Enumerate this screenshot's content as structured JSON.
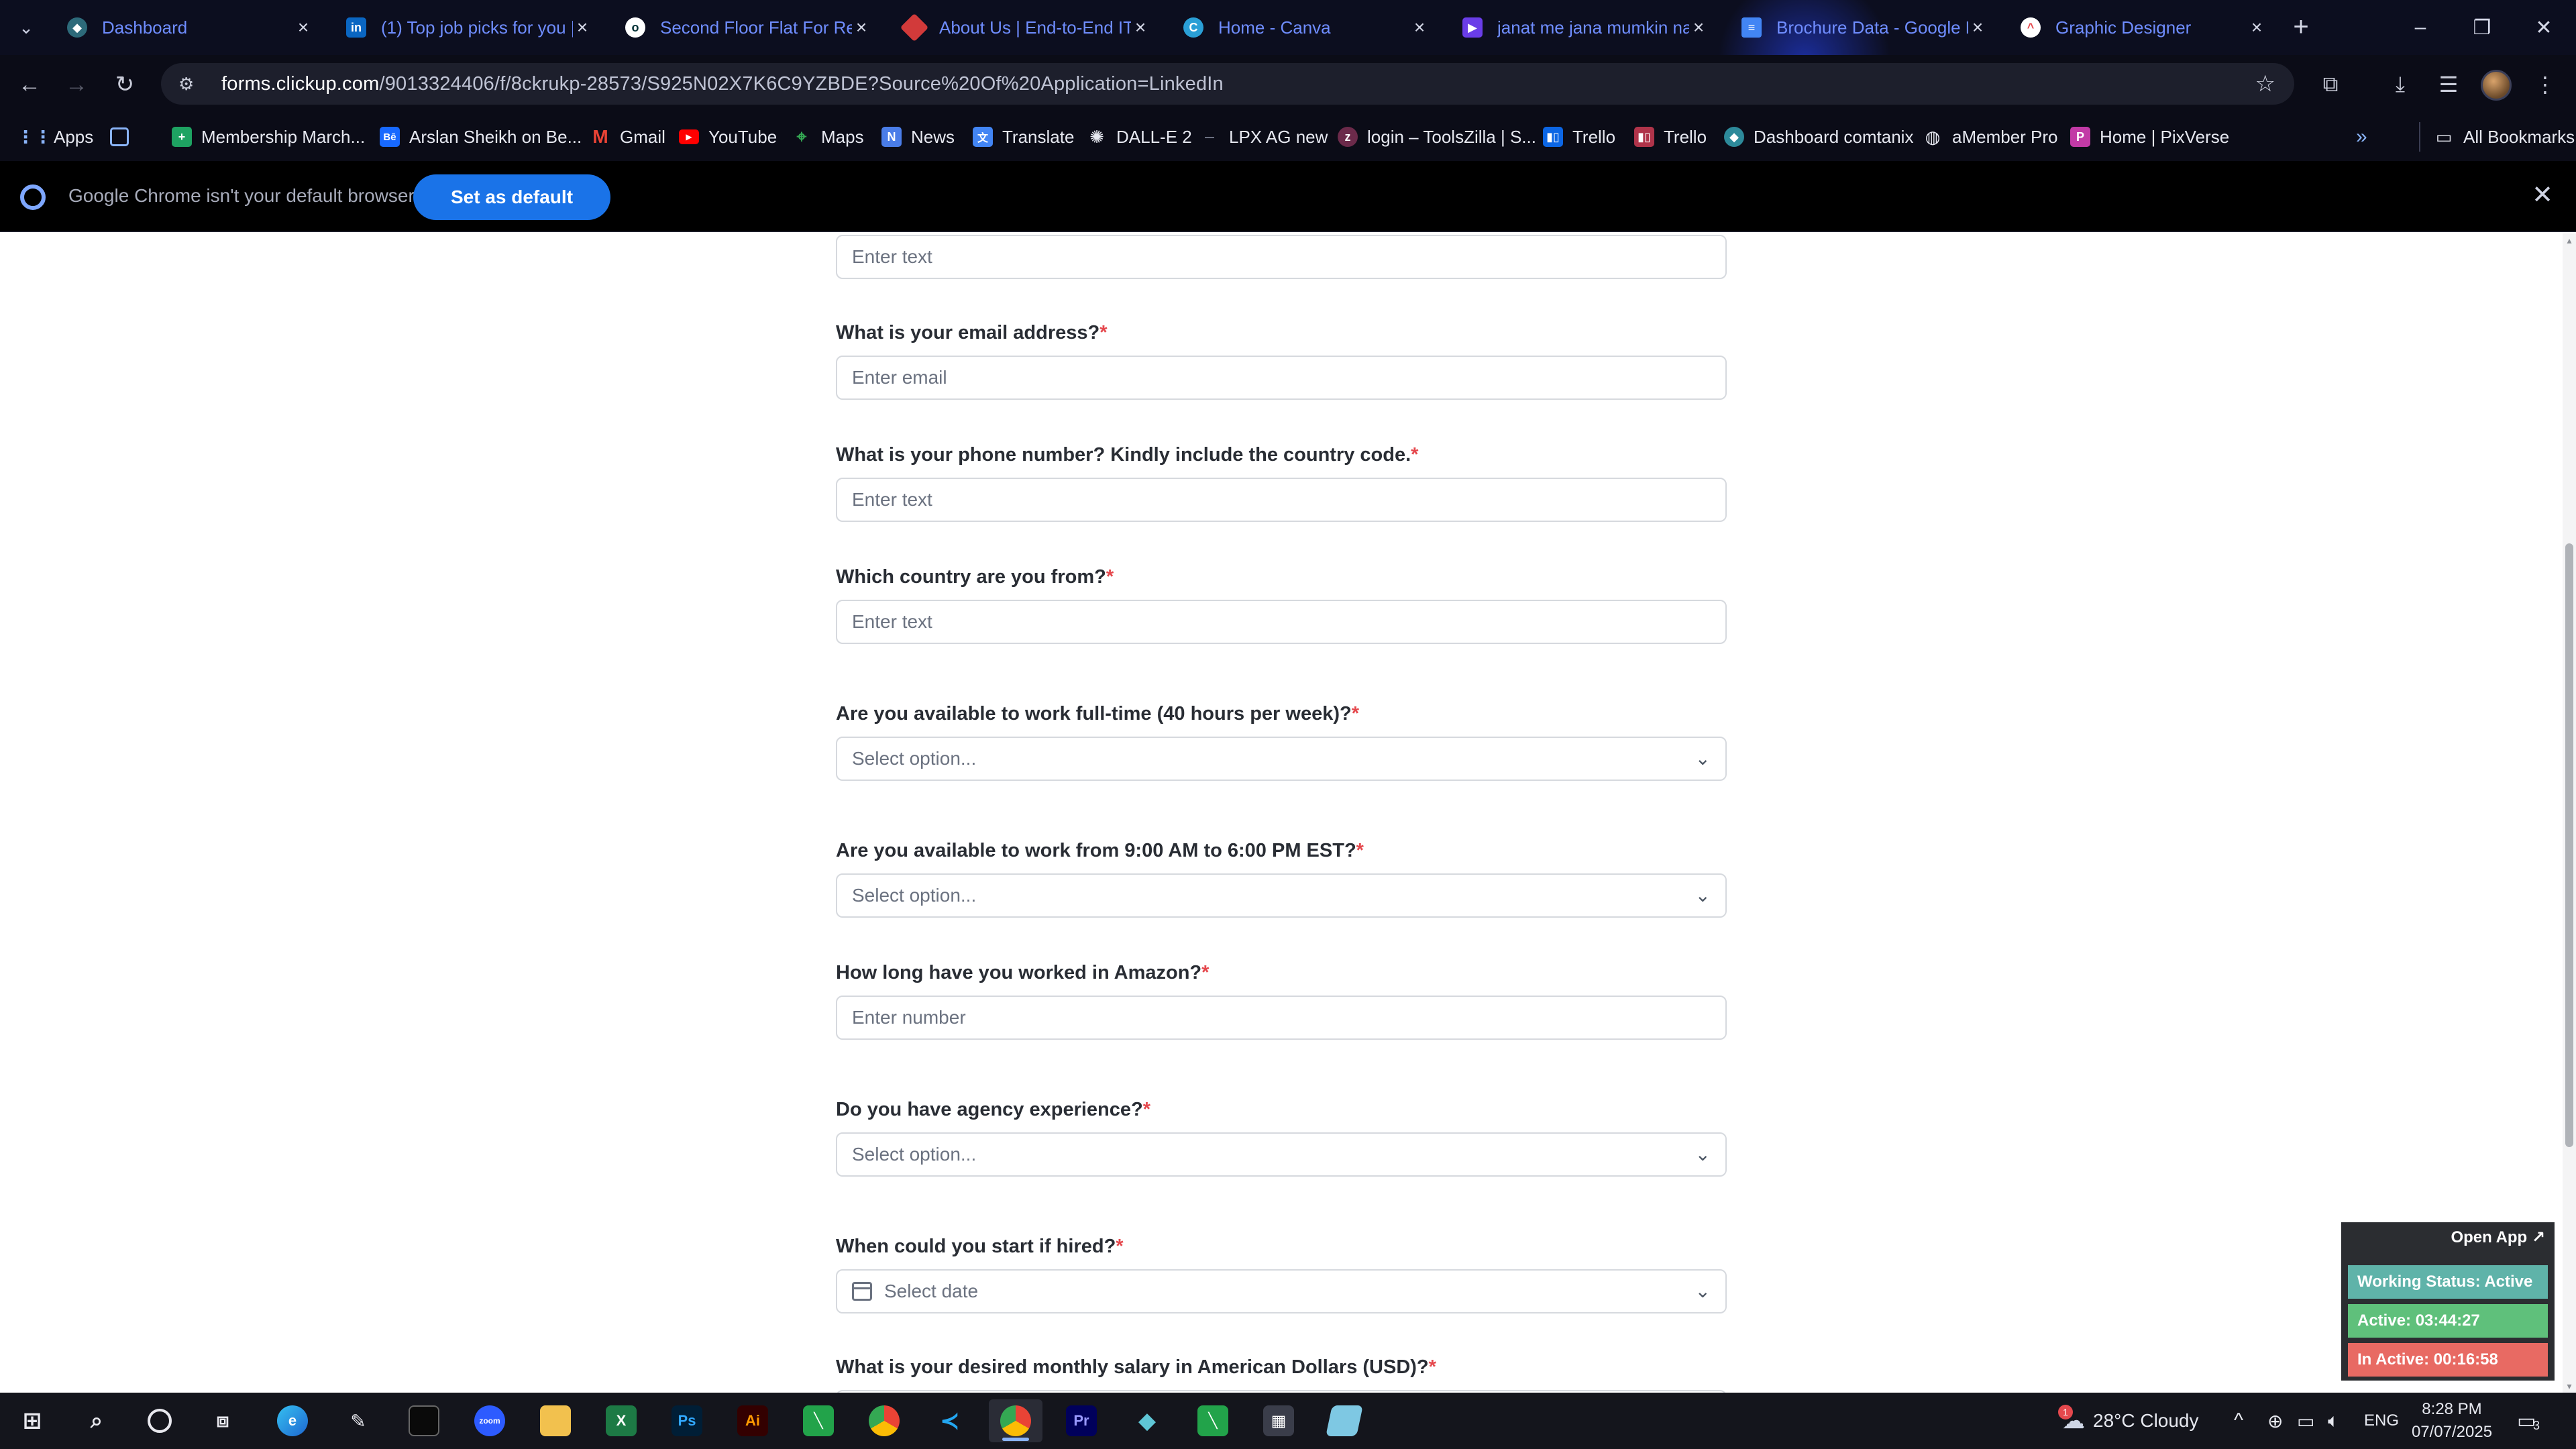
{
  "tabs": [
    {
      "title": "Dashboard",
      "icon": "dashboard-favicon"
    },
    {
      "title": "(1) Top job picks for you |",
      "icon": "linkedin-favicon"
    },
    {
      "title": "Second Floor Flat For Ren",
      "icon": "olx-favicon"
    },
    {
      "title": "About Us | End-to-End IT",
      "icon": "company-favicon"
    },
    {
      "title": "Home - Canva",
      "icon": "canva-favicon"
    },
    {
      "title": "janat me jana mumkin na",
      "icon": "video-favicon"
    },
    {
      "title": "Brochure Data - Google D",
      "icon": "google-docs-favicon"
    },
    {
      "title": "Graphic Designer",
      "icon": "clickup-favicon"
    }
  ],
  "toolbar": {
    "url_domain": "forms.clickup.com",
    "url_path": "/9013324406/f/8ckrukp-28573/S925N02X7K6C9YZBDE?Source%20Of%20Application=LinkedIn"
  },
  "bookmarks": [
    {
      "label": "Apps",
      "icon": "apps-grid-icon"
    },
    {
      "label": "",
      "icon": "tab-groups-icon"
    },
    {
      "label": "Membership March...",
      "icon": "sheets-icon"
    },
    {
      "label": "Arslan Sheikh on Be...",
      "icon": "behance-icon"
    },
    {
      "label": "Gmail",
      "icon": "gmail-icon"
    },
    {
      "label": "YouTube",
      "icon": "youtube-icon"
    },
    {
      "label": "Maps",
      "icon": "maps-icon"
    },
    {
      "label": "News",
      "icon": "news-icon"
    },
    {
      "label": "Translate",
      "icon": "translate-icon"
    },
    {
      "label": "DALL-E 2",
      "icon": "openai-icon"
    },
    {
      "label": "LPX AG new",
      "icon": "lpx-icon"
    },
    {
      "label": "login – ToolsZilla | S...",
      "icon": "toolszilla-icon"
    },
    {
      "label": "Trello",
      "icon": "trello-icon"
    },
    {
      "label": "Trello",
      "icon": "trello-icon"
    },
    {
      "label": "Dashboard comtanix",
      "icon": "comtanix-icon"
    },
    {
      "label": "aMember Pro",
      "icon": "amember-icon"
    },
    {
      "label": "Home | PixVerse",
      "icon": "pixverse-icon"
    }
  ],
  "all_bookmarks": "All Bookmarks",
  "infobar": {
    "message": "Google Chrome isn't your default browser",
    "button": "Set as default"
  },
  "form": {
    "fields": [
      {
        "label": "",
        "placeholder": "Enter text",
        "type": "text"
      },
      {
        "label": "What is your email address?",
        "placeholder": "Enter email",
        "type": "text"
      },
      {
        "label": "What is your phone number? Kindly include the country code.",
        "placeholder": "Enter text",
        "type": "text"
      },
      {
        "label": "Which country are you from?",
        "placeholder": "Enter text",
        "type": "text"
      },
      {
        "label": "Are you available to work full-time (40 hours per week)?",
        "placeholder": "Select option...",
        "type": "select"
      },
      {
        "label": "Are you available to work from 9:00 AM to 6:00 PM EST?",
        "placeholder": "Select option...",
        "type": "select"
      },
      {
        "label": "How long have you worked in Amazon?",
        "placeholder": "Enter number",
        "type": "text"
      },
      {
        "label": "Do you have agency experience?",
        "placeholder": "Select option...",
        "type": "select"
      },
      {
        "label": "When could you start if hired?",
        "placeholder": "Select date",
        "type": "date"
      },
      {
        "label": "What is your desired monthly salary in American Dollars (USD)?",
        "placeholder": "",
        "type": "text"
      }
    ],
    "required_marker": "*"
  },
  "tracker": {
    "open_app": "Open App ↗",
    "working_status": "Working Status: Active",
    "active": "Active: 03:44:27",
    "inactive": "In Active: 00:16:58"
  },
  "taskbar": {
    "weather": "28°C  Cloudy",
    "weather_badge": "1",
    "language": "ENG",
    "time": "8:28 PM",
    "date": "07/07/2025",
    "notifications": "3"
  },
  "colors": {
    "required": "#e5484d",
    "primary_button": "#1a73e8",
    "tab_text": "#6f8dff",
    "tracker_status": "#5fb3a9",
    "tracker_active": "#5fc07b",
    "tracker_inactive": "#e86a63"
  }
}
